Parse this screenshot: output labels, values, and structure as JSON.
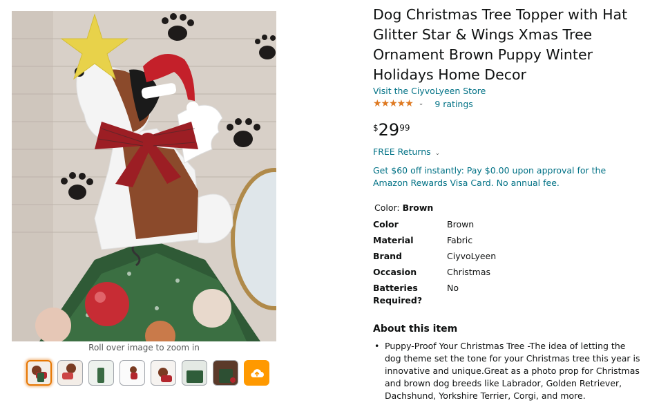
{
  "gallery": {
    "zoom_hint": "Roll over image to zoom in",
    "thumbnails": [
      "thumb-1",
      "thumb-2",
      "thumb-3",
      "thumb-4",
      "thumb-5",
      "thumb-6",
      "thumb-7"
    ],
    "selected_index": 0,
    "upload_icon": "cloud-upload-icon"
  },
  "product": {
    "title": "Dog Christmas Tree Topper with Hat Glitter Star & Wings Xmas Tree Ornament Brown Puppy Winter Holidays Home Decor",
    "store_link": "Visit the CiyvoLyeen Store",
    "rating_stars": "★★★★★",
    "ratings_count": "9 ratings",
    "price": {
      "symbol": "$",
      "whole": "29",
      "fraction": "99"
    },
    "returns": "FREE Returns",
    "offer": "Get $60 off instantly: Pay $0.00 upon approval for the Amazon Rewards Visa Card. No annual fee.",
    "color_label": "Color: ",
    "color_value": "Brown"
  },
  "specs": [
    {
      "key": "Color",
      "value": "Brown"
    },
    {
      "key": "Material",
      "value": "Fabric"
    },
    {
      "key": "Brand",
      "value": "CiyvoLyeen"
    },
    {
      "key": "Occasion",
      "value": "Christmas"
    },
    {
      "key": "Batteries Required?",
      "value": "No"
    }
  ],
  "about": {
    "heading": "About this item",
    "bullets": [
      "Puppy-Proof Your Christmas Tree -The idea of letting the dog theme set the tone for your Christmas tree this year is innovative and unique.Great as a photo prop for Christmas and brown dog breeds like Labrador, Golden Retriever, Dachshund, Yorkshire Terrier, Corgi, and more."
    ]
  },
  "colors": {
    "link": "#007185",
    "star": "#de7921",
    "selected_border": "#e77600",
    "upload_bg": "#ff9900"
  }
}
